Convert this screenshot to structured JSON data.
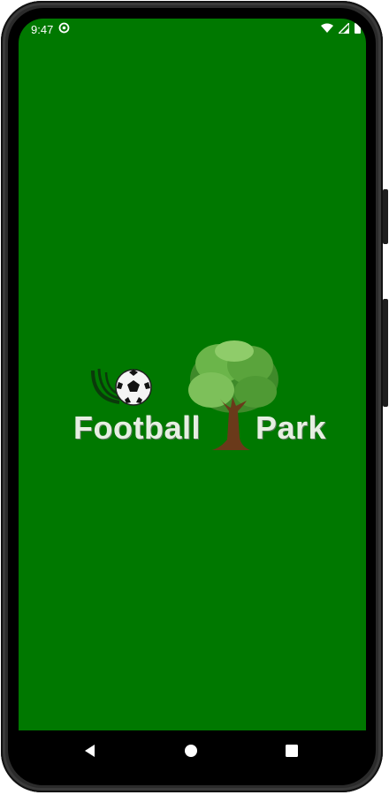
{
  "status_bar": {
    "time": "9:47",
    "notification_icon": "at-sign-icon",
    "wifi_icon": "wifi-icon",
    "signal_icon": "cell-signal-icon",
    "battery_icon": "battery-icon"
  },
  "splash": {
    "background_color": "#007800",
    "logo_word_1": "Football",
    "logo_word_2": "Park",
    "logo_icons": [
      "soccer-ball-icon",
      "tree-icon"
    ]
  },
  "nav_bar": {
    "back_icon": "back-triangle-icon",
    "home_icon": "home-circle-icon",
    "recents_icon": "recents-square-icon"
  }
}
